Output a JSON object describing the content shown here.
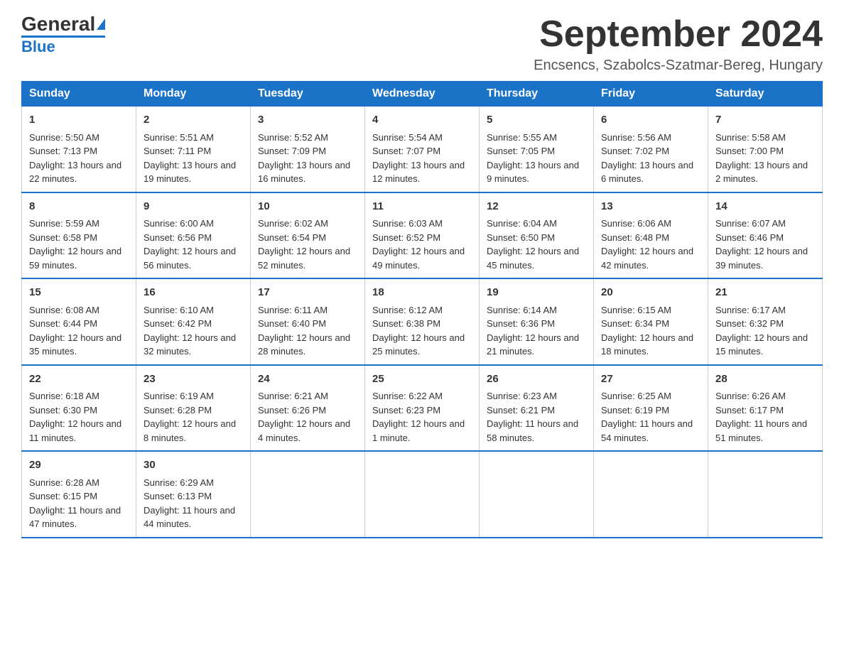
{
  "logo": {
    "general": "General",
    "blue": "Blue"
  },
  "header": {
    "month": "September 2024",
    "location": "Encsencs, Szabolcs-Szatmar-Bereg, Hungary"
  },
  "days": [
    "Sunday",
    "Monday",
    "Tuesday",
    "Wednesday",
    "Thursday",
    "Friday",
    "Saturday"
  ],
  "weeks": [
    [
      {
        "day": "1",
        "sunrise": "Sunrise: 5:50 AM",
        "sunset": "Sunset: 7:13 PM",
        "daylight": "Daylight: 13 hours and 22 minutes."
      },
      {
        "day": "2",
        "sunrise": "Sunrise: 5:51 AM",
        "sunset": "Sunset: 7:11 PM",
        "daylight": "Daylight: 13 hours and 19 minutes."
      },
      {
        "day": "3",
        "sunrise": "Sunrise: 5:52 AM",
        "sunset": "Sunset: 7:09 PM",
        "daylight": "Daylight: 13 hours and 16 minutes."
      },
      {
        "day": "4",
        "sunrise": "Sunrise: 5:54 AM",
        "sunset": "Sunset: 7:07 PM",
        "daylight": "Daylight: 13 hours and 12 minutes."
      },
      {
        "day": "5",
        "sunrise": "Sunrise: 5:55 AM",
        "sunset": "Sunset: 7:05 PM",
        "daylight": "Daylight: 13 hours and 9 minutes."
      },
      {
        "day": "6",
        "sunrise": "Sunrise: 5:56 AM",
        "sunset": "Sunset: 7:02 PM",
        "daylight": "Daylight: 13 hours and 6 minutes."
      },
      {
        "day": "7",
        "sunrise": "Sunrise: 5:58 AM",
        "sunset": "Sunset: 7:00 PM",
        "daylight": "Daylight: 13 hours and 2 minutes."
      }
    ],
    [
      {
        "day": "8",
        "sunrise": "Sunrise: 5:59 AM",
        "sunset": "Sunset: 6:58 PM",
        "daylight": "Daylight: 12 hours and 59 minutes."
      },
      {
        "day": "9",
        "sunrise": "Sunrise: 6:00 AM",
        "sunset": "Sunset: 6:56 PM",
        "daylight": "Daylight: 12 hours and 56 minutes."
      },
      {
        "day": "10",
        "sunrise": "Sunrise: 6:02 AM",
        "sunset": "Sunset: 6:54 PM",
        "daylight": "Daylight: 12 hours and 52 minutes."
      },
      {
        "day": "11",
        "sunrise": "Sunrise: 6:03 AM",
        "sunset": "Sunset: 6:52 PM",
        "daylight": "Daylight: 12 hours and 49 minutes."
      },
      {
        "day": "12",
        "sunrise": "Sunrise: 6:04 AM",
        "sunset": "Sunset: 6:50 PM",
        "daylight": "Daylight: 12 hours and 45 minutes."
      },
      {
        "day": "13",
        "sunrise": "Sunrise: 6:06 AM",
        "sunset": "Sunset: 6:48 PM",
        "daylight": "Daylight: 12 hours and 42 minutes."
      },
      {
        "day": "14",
        "sunrise": "Sunrise: 6:07 AM",
        "sunset": "Sunset: 6:46 PM",
        "daylight": "Daylight: 12 hours and 39 minutes."
      }
    ],
    [
      {
        "day": "15",
        "sunrise": "Sunrise: 6:08 AM",
        "sunset": "Sunset: 6:44 PM",
        "daylight": "Daylight: 12 hours and 35 minutes."
      },
      {
        "day": "16",
        "sunrise": "Sunrise: 6:10 AM",
        "sunset": "Sunset: 6:42 PM",
        "daylight": "Daylight: 12 hours and 32 minutes."
      },
      {
        "day": "17",
        "sunrise": "Sunrise: 6:11 AM",
        "sunset": "Sunset: 6:40 PM",
        "daylight": "Daylight: 12 hours and 28 minutes."
      },
      {
        "day": "18",
        "sunrise": "Sunrise: 6:12 AM",
        "sunset": "Sunset: 6:38 PM",
        "daylight": "Daylight: 12 hours and 25 minutes."
      },
      {
        "day": "19",
        "sunrise": "Sunrise: 6:14 AM",
        "sunset": "Sunset: 6:36 PM",
        "daylight": "Daylight: 12 hours and 21 minutes."
      },
      {
        "day": "20",
        "sunrise": "Sunrise: 6:15 AM",
        "sunset": "Sunset: 6:34 PM",
        "daylight": "Daylight: 12 hours and 18 minutes."
      },
      {
        "day": "21",
        "sunrise": "Sunrise: 6:17 AM",
        "sunset": "Sunset: 6:32 PM",
        "daylight": "Daylight: 12 hours and 15 minutes."
      }
    ],
    [
      {
        "day": "22",
        "sunrise": "Sunrise: 6:18 AM",
        "sunset": "Sunset: 6:30 PM",
        "daylight": "Daylight: 12 hours and 11 minutes."
      },
      {
        "day": "23",
        "sunrise": "Sunrise: 6:19 AM",
        "sunset": "Sunset: 6:28 PM",
        "daylight": "Daylight: 12 hours and 8 minutes."
      },
      {
        "day": "24",
        "sunrise": "Sunrise: 6:21 AM",
        "sunset": "Sunset: 6:26 PM",
        "daylight": "Daylight: 12 hours and 4 minutes."
      },
      {
        "day": "25",
        "sunrise": "Sunrise: 6:22 AM",
        "sunset": "Sunset: 6:23 PM",
        "daylight": "Daylight: 12 hours and 1 minute."
      },
      {
        "day": "26",
        "sunrise": "Sunrise: 6:23 AM",
        "sunset": "Sunset: 6:21 PM",
        "daylight": "Daylight: 11 hours and 58 minutes."
      },
      {
        "day": "27",
        "sunrise": "Sunrise: 6:25 AM",
        "sunset": "Sunset: 6:19 PM",
        "daylight": "Daylight: 11 hours and 54 minutes."
      },
      {
        "day": "28",
        "sunrise": "Sunrise: 6:26 AM",
        "sunset": "Sunset: 6:17 PM",
        "daylight": "Daylight: 11 hours and 51 minutes."
      }
    ],
    [
      {
        "day": "29",
        "sunrise": "Sunrise: 6:28 AM",
        "sunset": "Sunset: 6:15 PM",
        "daylight": "Daylight: 11 hours and 47 minutes."
      },
      {
        "day": "30",
        "sunrise": "Sunrise: 6:29 AM",
        "sunset": "Sunset: 6:13 PM",
        "daylight": "Daylight: 11 hours and 44 minutes."
      },
      null,
      null,
      null,
      null,
      null
    ]
  ]
}
